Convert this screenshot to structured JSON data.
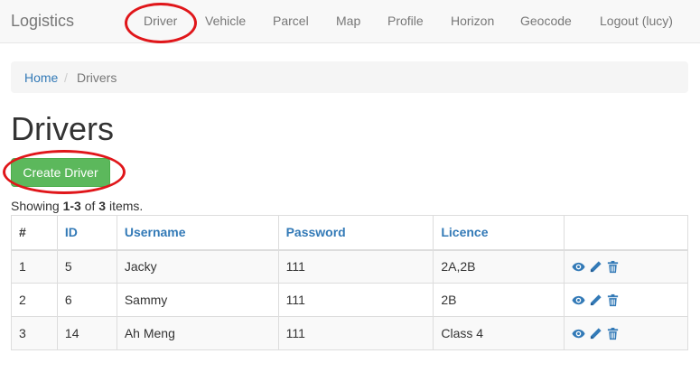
{
  "navbar": {
    "brand": "Logistics",
    "items": [
      {
        "label": "Driver"
      },
      {
        "label": "Vehicle"
      },
      {
        "label": "Parcel"
      },
      {
        "label": "Map"
      },
      {
        "label": "Profile"
      },
      {
        "label": "Horizon"
      },
      {
        "label": "Geocode"
      },
      {
        "label": "Logout (lucy)"
      }
    ]
  },
  "breadcrumb": {
    "home": "Home",
    "separator": "/",
    "active": "Drivers"
  },
  "page": {
    "title": "Drivers",
    "create_button": "Create Driver"
  },
  "summary": {
    "prefix": "Showing ",
    "range": "1-3",
    "middle": " of ",
    "total": "3",
    "suffix": " items."
  },
  "table": {
    "headers": [
      "#",
      "ID",
      "Username",
      "Password",
      "Licence",
      ""
    ],
    "rows": [
      {
        "num": "1",
        "id": "5",
        "username": "Jacky",
        "password": "111",
        "licence": "2A,2B"
      },
      {
        "num": "2",
        "id": "6",
        "username": "Sammy",
        "password": "111",
        "licence": "2B"
      },
      {
        "num": "3",
        "id": "14",
        "username": "Ah Meng",
        "password": "111",
        "licence": "Class 4"
      }
    ],
    "action_icons": [
      "eye-icon",
      "pencil-icon",
      "trash-icon"
    ]
  },
  "colors": {
    "link": "#337ab7",
    "success": "#5cb85c",
    "annotation": "#e0161a",
    "navbar_bg": "#f8f8f8"
  }
}
